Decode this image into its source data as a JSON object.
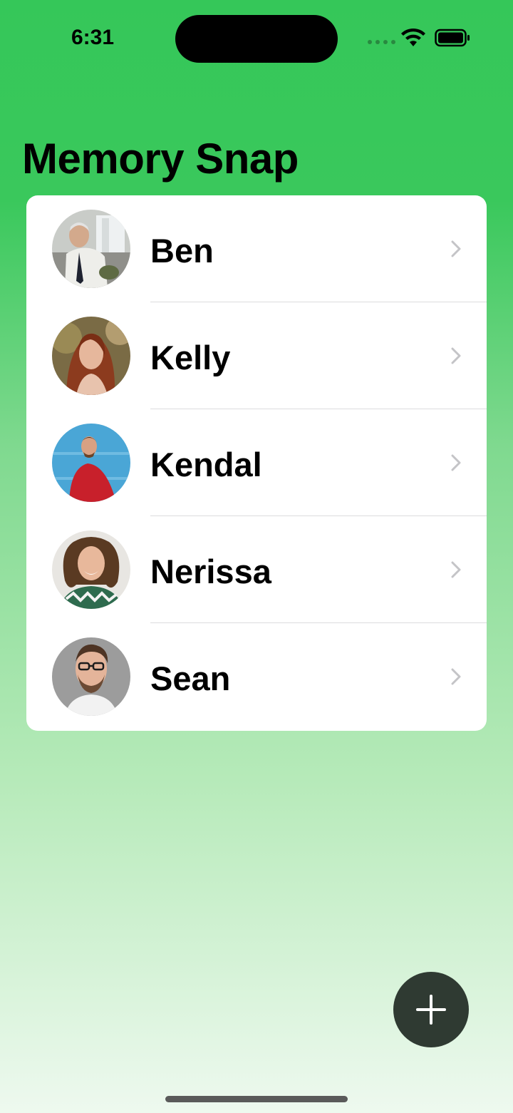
{
  "status": {
    "time": "6:31"
  },
  "app": {
    "title": "Memory Snap"
  },
  "contacts": [
    {
      "name": "Ben",
      "avatar": "elderly-man-in-office-photo"
    },
    {
      "name": "Kelly",
      "avatar": "woman-with-auburn-hair-photo"
    },
    {
      "name": "Kendal",
      "avatar": "man-in-red-sweater-photo"
    },
    {
      "name": "Nerissa",
      "avatar": "smiling-woman-with-curly-hair-photo"
    },
    {
      "name": "Sean",
      "avatar": "man-with-glasses-photo"
    }
  ],
  "fab": {
    "icon": "plus-icon"
  },
  "colors": {
    "background_top": "#35c759",
    "background_bottom": "#eef9ef",
    "fab": "#2f3a32",
    "chevron": "#c4c4c7"
  }
}
